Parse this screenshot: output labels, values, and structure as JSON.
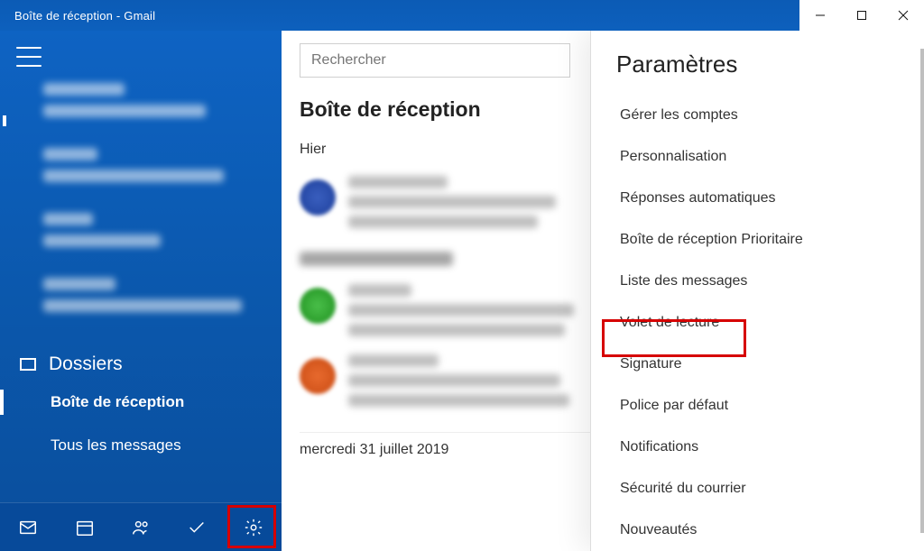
{
  "window": {
    "title": "Boîte de réception - Gmail"
  },
  "sidebar": {
    "folders_header": "Dossiers",
    "folder_inbox": "Boîte de réception",
    "folder_all": "Tous les messages"
  },
  "content": {
    "search_placeholder": "Rechercher",
    "inbox_title": "Boîte de réception",
    "group1": "Hier",
    "group3": "mercredi 31 juillet 2019"
  },
  "settings": {
    "title": "Paramètres",
    "items": [
      "Gérer les comptes",
      "Personnalisation",
      "Réponses automatiques",
      "Boîte de réception Prioritaire",
      "Liste des messages",
      "Volet de lecture",
      "Signature",
      "Police par défaut",
      "Notifications",
      "Sécurité du courrier",
      "Nouveautés"
    ]
  }
}
